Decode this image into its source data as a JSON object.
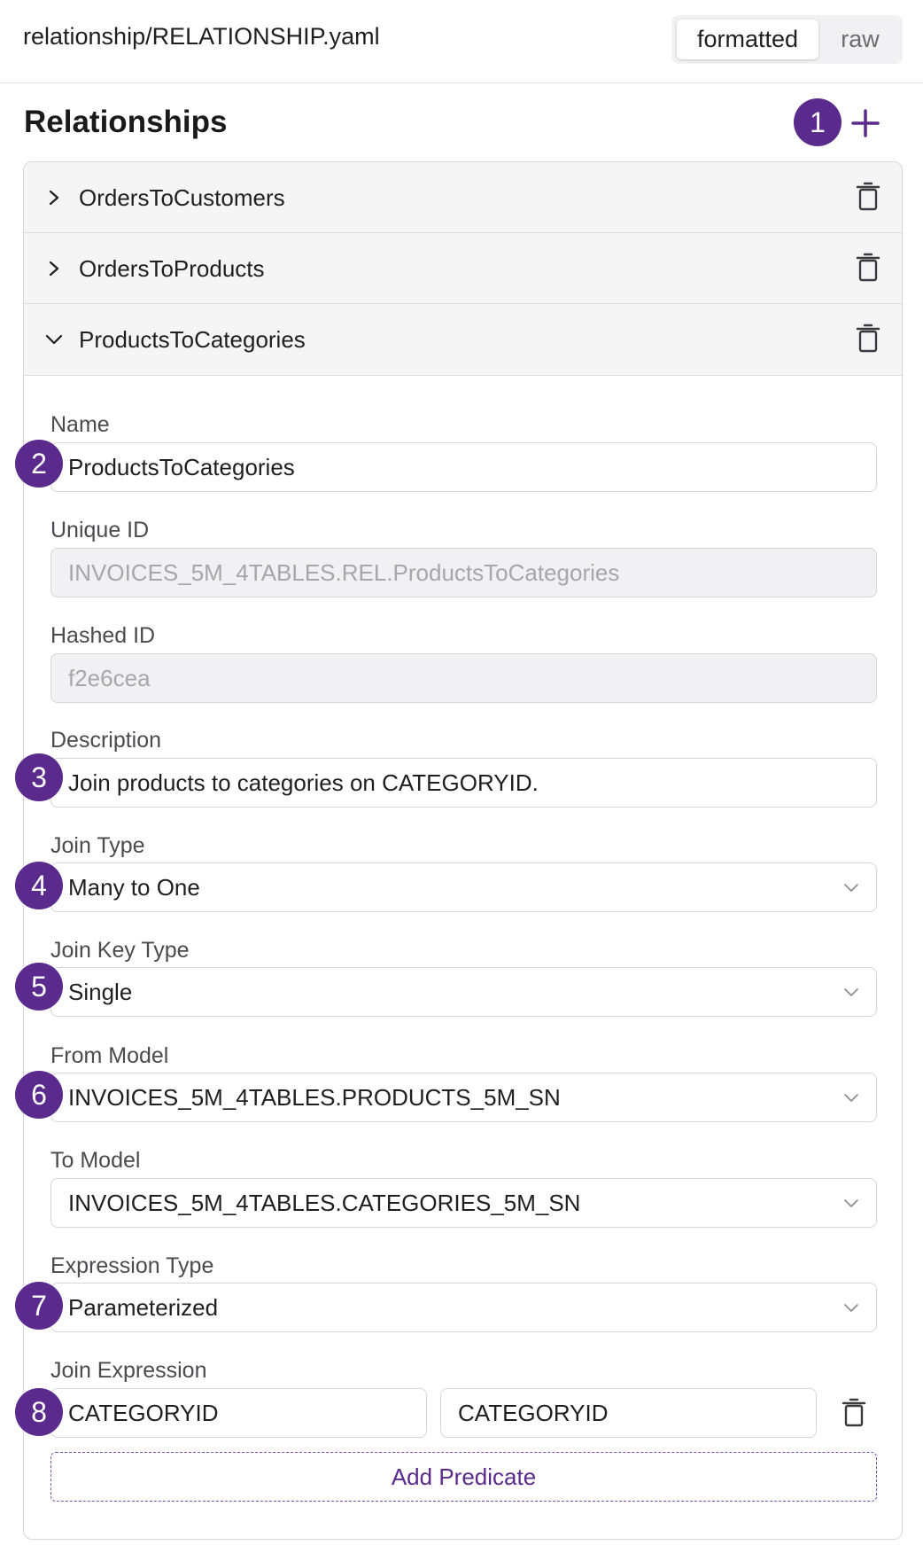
{
  "header": {
    "file_path": "relationship/RELATIONSHIP.yaml",
    "view_toggle": {
      "formatted_label": "formatted",
      "raw_label": "raw",
      "selected": "formatted"
    }
  },
  "section": {
    "title": "Relationships"
  },
  "badges": [
    "1",
    "2",
    "3",
    "4",
    "5",
    "6",
    "7",
    "8"
  ],
  "icons": {
    "add": "plus-icon",
    "delete": "trash-icon",
    "collapsed": "chevron-right-icon",
    "expanded": "chevron-down-icon",
    "select": "chevron-down-icon"
  },
  "colors": {
    "accent": "#5a2a8c",
    "badge_bg": "#5a2a8c",
    "border": "#d6d6da",
    "row_bg": "#f5f5f6"
  },
  "relationships": [
    {
      "label": "OrdersToCustomers",
      "expanded": false
    },
    {
      "label": "OrdersToProducts",
      "expanded": false
    },
    {
      "label": "ProductsToCategories",
      "expanded": true
    }
  ],
  "form": {
    "name": {
      "label": "Name",
      "value": "ProductsToCategories"
    },
    "unique_id": {
      "label": "Unique ID",
      "value": "INVOICES_5M_4TABLES.REL.ProductsToCategories"
    },
    "hashed_id": {
      "label": "Hashed ID",
      "value": "f2e6cea"
    },
    "description": {
      "label": "Description",
      "value": "Join products to categories on CATEGORYID."
    },
    "join_type": {
      "label": "Join Type",
      "value": "Many to One"
    },
    "join_key_type": {
      "label": "Join Key Type",
      "value": "Single"
    },
    "from_model": {
      "label": "From Model",
      "value": "INVOICES_5M_4TABLES.PRODUCTS_5M_SN"
    },
    "to_model": {
      "label": "To Model",
      "value": "INVOICES_5M_4TABLES.CATEGORIES_5M_SN"
    },
    "expression_type": {
      "label": "Expression Type",
      "value": "Parameterized"
    },
    "join_expression": {
      "label": "Join Expression",
      "left": "CATEGORYID",
      "right": "CATEGORYID"
    },
    "add_predicate_label": "Add Predicate"
  }
}
